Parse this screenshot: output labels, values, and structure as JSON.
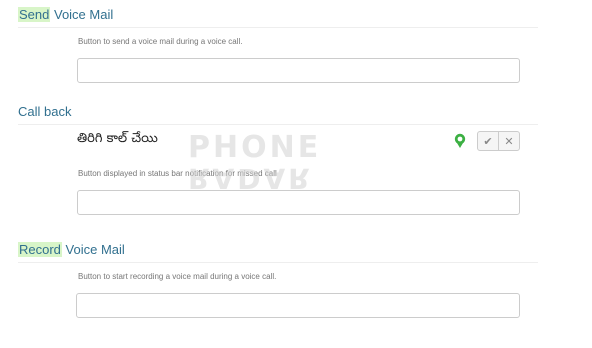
{
  "sections": {
    "send_voice_mail": {
      "title_highlight": "Send",
      "title_rest": " Voice Mail",
      "description": "Button to send a voice mail during a voice call.",
      "input_value": ""
    },
    "call_back": {
      "title": "Call back",
      "translation": "తిరిగి కాల్ చేయి",
      "description": "Button displayed in status bar notification for missed call",
      "input_value": ""
    },
    "record_voice_mail": {
      "title_highlight": "Record",
      "title_rest": " Voice Mail",
      "description": "Button to start recording a voice mail during a voice call.",
      "input_value": ""
    }
  },
  "icons": {
    "approve": "check-icon",
    "reject": "close-icon",
    "badge": "award-icon"
  },
  "watermark": {
    "line1": "PHONE",
    "line2": "RADAR"
  },
  "colors": {
    "title": "#31708f",
    "highlight": "#d8f5c8",
    "badge": "#3cb043"
  }
}
